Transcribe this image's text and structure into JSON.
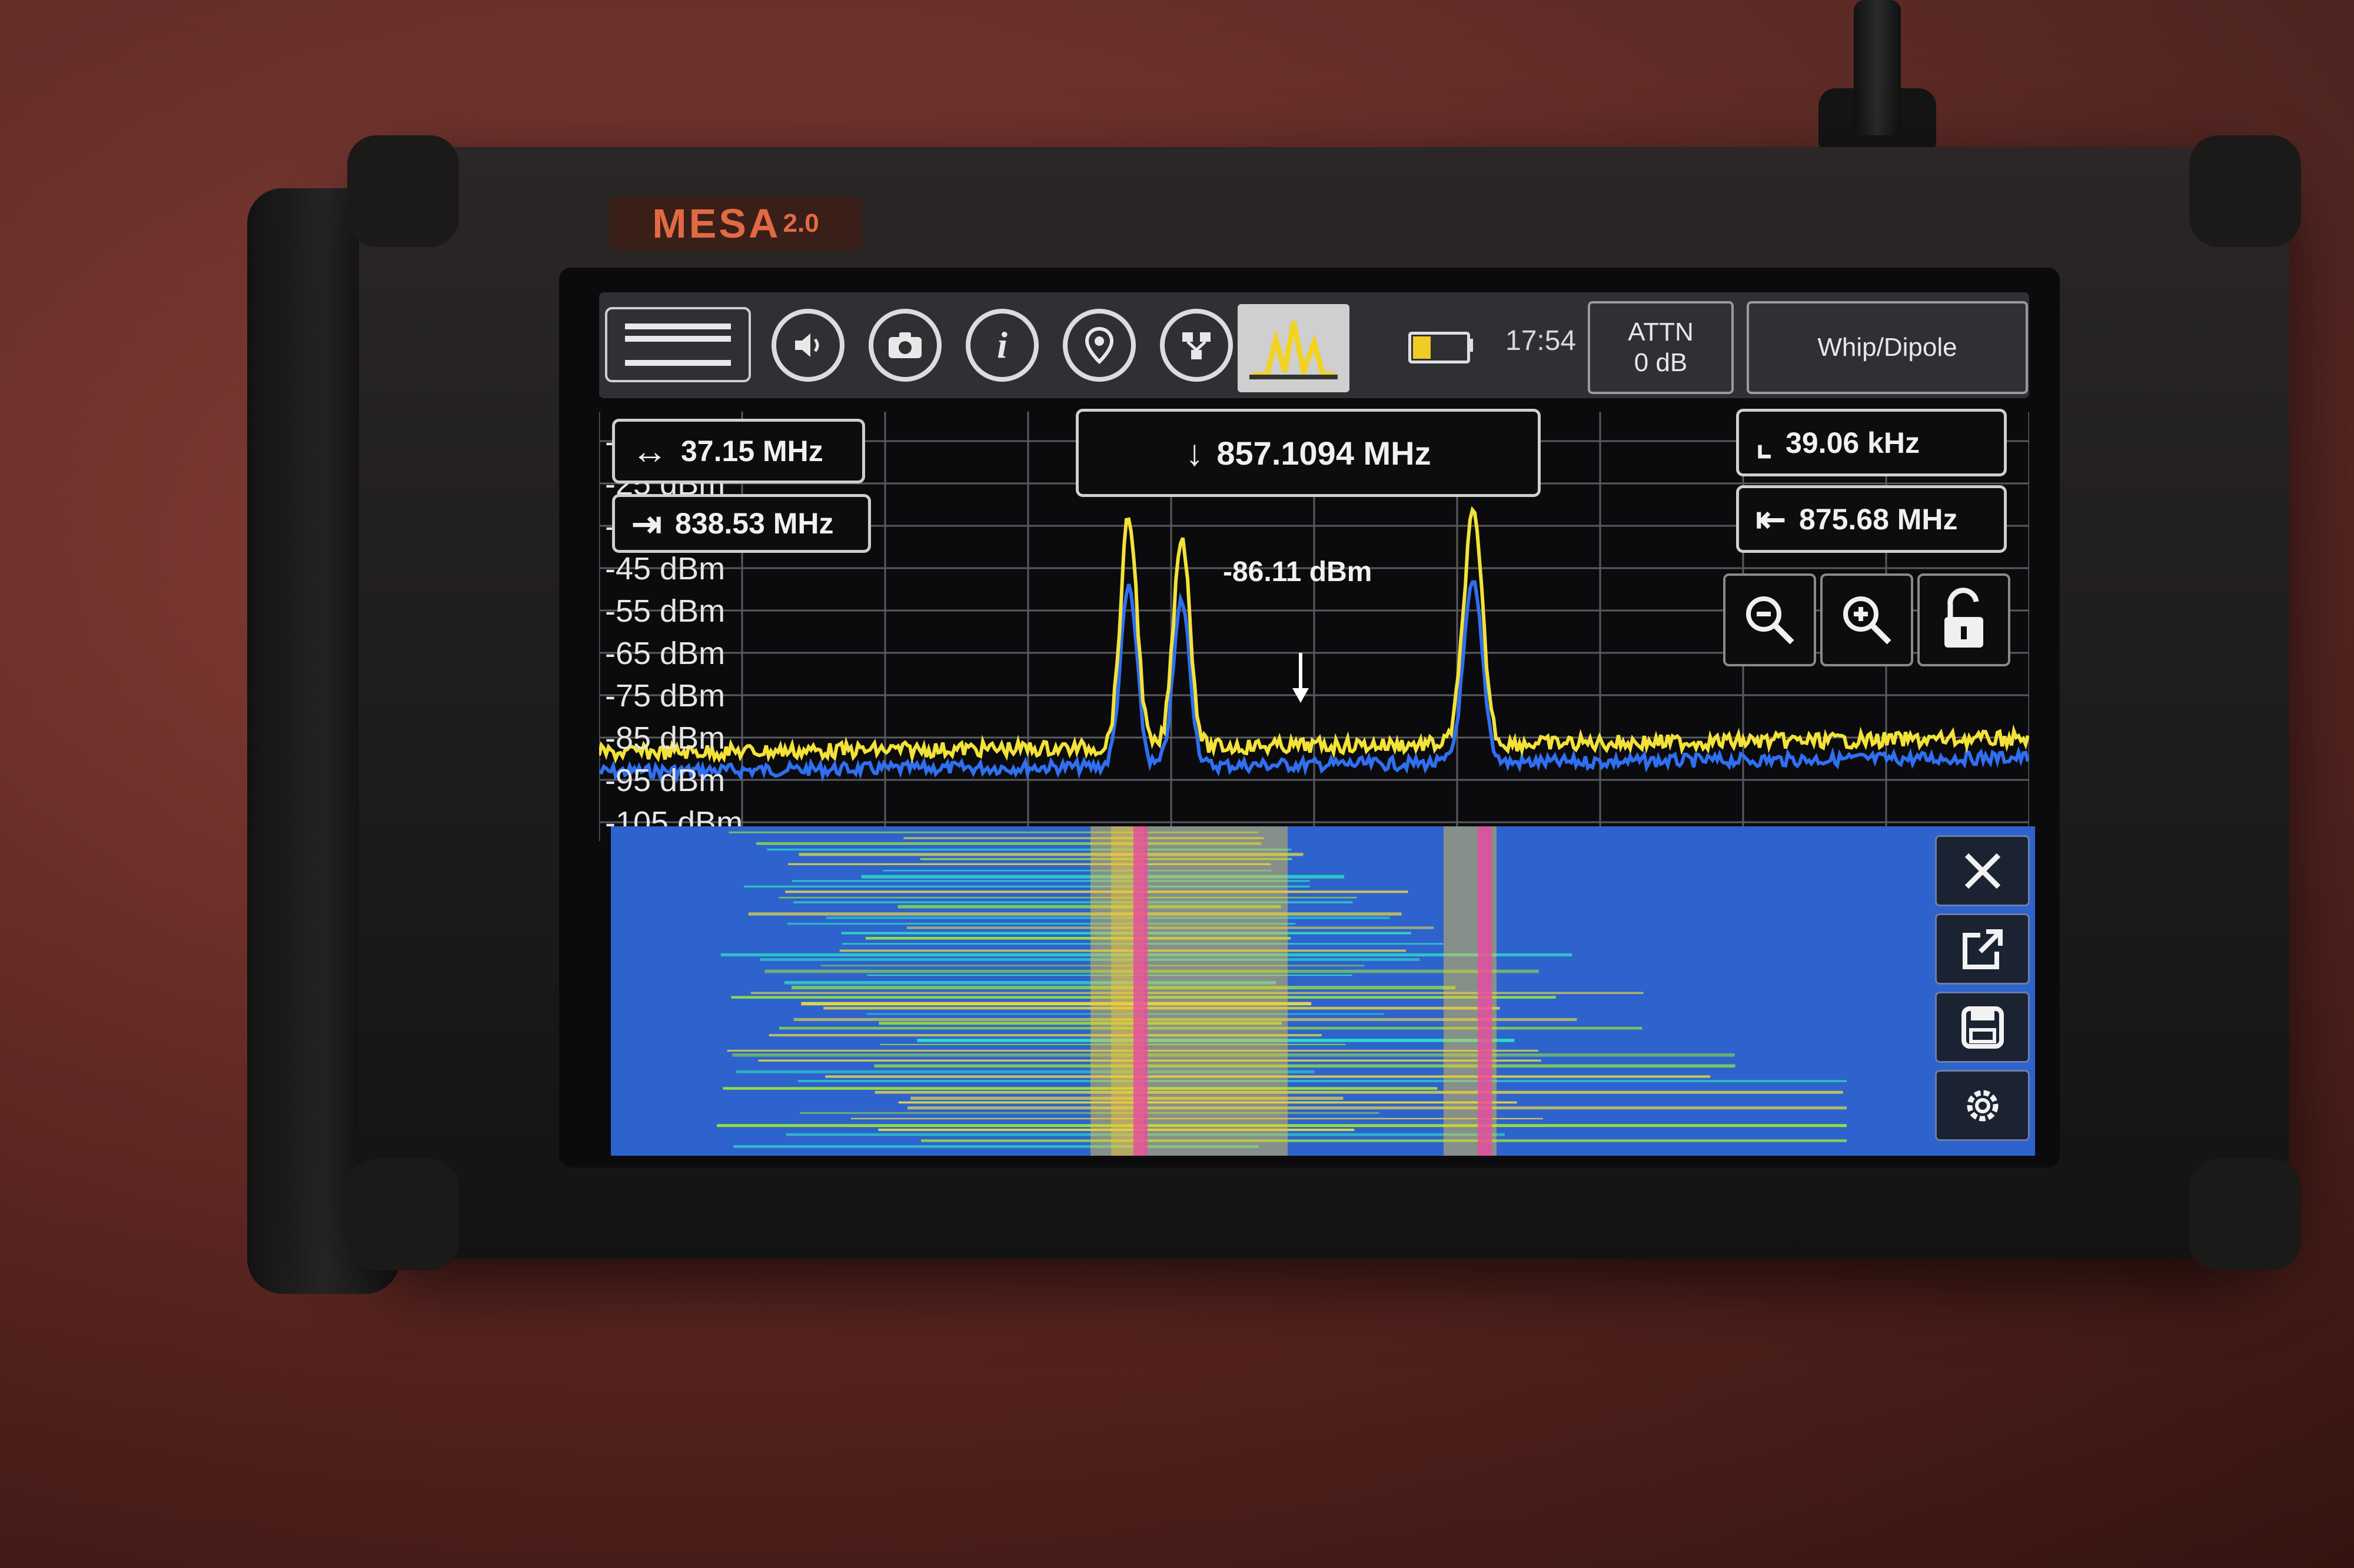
{
  "brand": {
    "name": "MESA",
    "version": "2.0"
  },
  "toolbar": {
    "battery_level": 0.35,
    "time": "17:54",
    "attn_label": "ATTN",
    "attn_value": "0 dB",
    "antenna": "Whip/Dipole"
  },
  "readouts": {
    "span": "37.15 MHz",
    "start_freq": "838.53 MHz",
    "marker_freq": "857.1094 MHz",
    "rbw": "39.06 kHz",
    "stop_freq": "875.68 MHz",
    "marker_level": "-86.11 dBm"
  },
  "y_axis_labels": [
    "-15 dBm",
    "-25 dBm",
    "-35 dBm",
    "-45 dBm",
    "-55 dBm",
    "-65 dBm",
    "-75 dBm",
    "-85 dBm",
    "-95 dBm",
    "-105 dBm"
  ],
  "colors": {
    "trace_max": "#f3e23a",
    "trace_live": "#2f6ff0",
    "waterfall_bg": "#2e62cc"
  },
  "icons": {
    "menu": "menu-icon",
    "audio": "speaker-icon",
    "camera": "camera-icon",
    "info": "info-icon",
    "location": "location-pin-icon",
    "network": "network-icon",
    "spectrum": "spectrum-icon",
    "zoom_out": "zoom-out-icon",
    "zoom_in": "zoom-in-icon",
    "lock": "unlock-icon",
    "close": "close-icon",
    "popout": "popout-icon",
    "save": "save-icon",
    "settings": "gear-icon"
  }
}
